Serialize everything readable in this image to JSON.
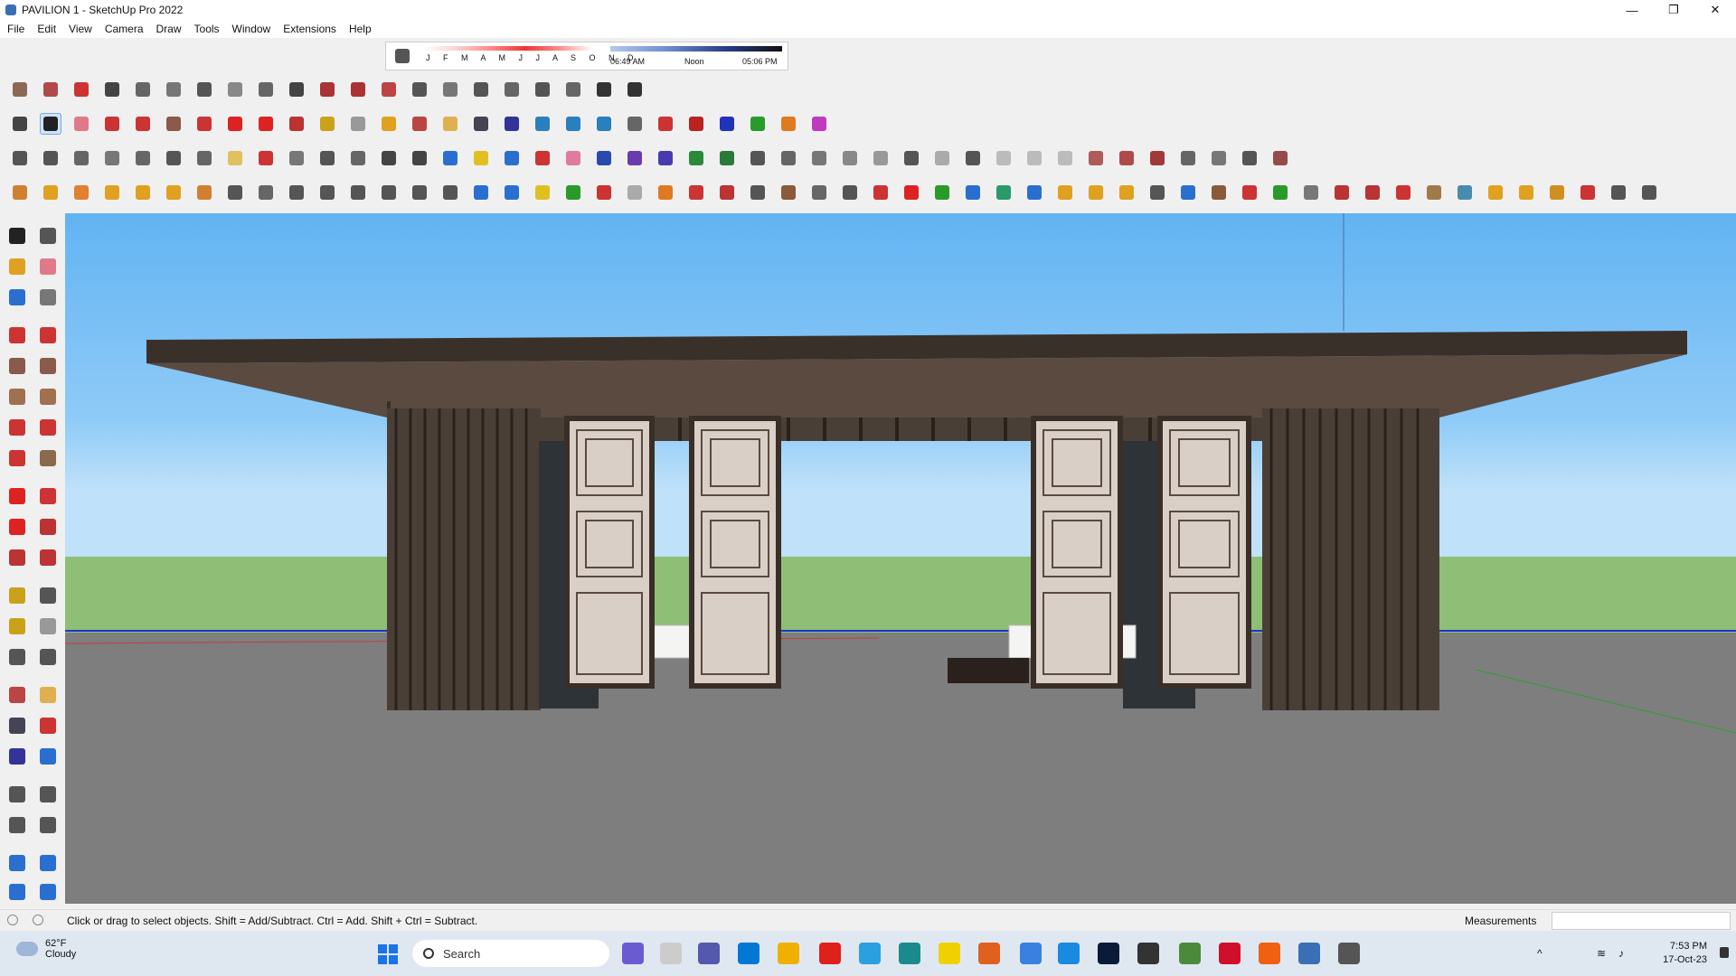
{
  "window": {
    "title": "PAVILION 1 - SketchUp Pro 2022"
  },
  "menu": [
    "File",
    "Edit",
    "View",
    "Camera",
    "Draw",
    "Tools",
    "Window",
    "Extensions",
    "Help"
  ],
  "shadow": {
    "months": "J F M A M J J A S O N D",
    "sunrise": "06:49 AM",
    "noon": "Noon",
    "sunset": "05:06 PM"
  },
  "status": {
    "hint": "Click or drag to select objects. Shift = Add/Subtract. Ctrl = Add. Shift + Ctrl = Subtract.",
    "measurements_label": "Measurements",
    "measurements_value": ""
  },
  "taskbar": {
    "search_placeholder": "Search",
    "weather_temp": "62°F",
    "weather_cond": "Cloudy",
    "time": "7:53 PM",
    "date": "17-Oct-23"
  },
  "colors": {
    "sky": "#8fcbf7",
    "grass": "#8fbf76",
    "ground": "#7e7e7e",
    "roof": "#3a302a",
    "post": "#4a3f37",
    "screen": "#d9cfc6"
  }
}
